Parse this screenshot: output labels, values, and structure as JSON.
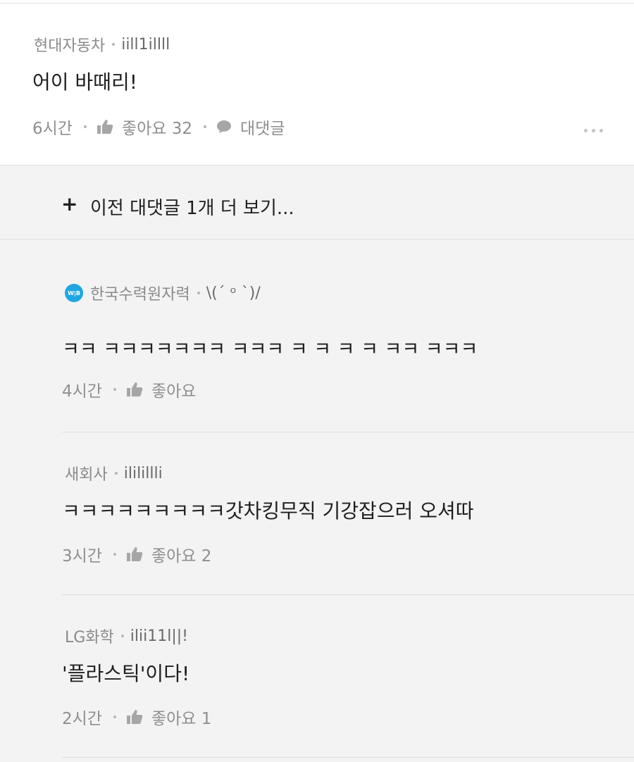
{
  "main_comment": {
    "company": "현대자동차",
    "user_id": "iill1illll",
    "text": "어이 바때리!",
    "time": "6시간",
    "like_label": "좋아요 32",
    "reply_label": "대댓글"
  },
  "prev_replies": {
    "plus": "+",
    "label": "이전 대댓글 1개 더 보기..."
  },
  "replies": [
    {
      "company": "한국수력원자력",
      "user_id": "\\(´ ᵒ `)/",
      "badge": "W|B",
      "text": "ㅋㅋ ㅋㅋㅋㅋㅋㅋㅋ ㅋㅋㅋ ㅋ ㅋ ㅋ ㅋ ㅋㅋ ㅋㅋㅋ",
      "time": "4시간",
      "like_label": "좋아요"
    },
    {
      "company": "새회사",
      "user_id": "ililillli",
      "text": "ㅋㅋㅋㅋㅋㅋㅋㅋㅋ갓차킹무직 기강잡으러 오셔따",
      "time": "3시간",
      "like_label": "좋아요 2"
    },
    {
      "company": "LG화학",
      "user_id": "ilii11l||!",
      "text": "'플라스틱'이다!",
      "time": "2시간",
      "like_label": "좋아요 1"
    }
  ],
  "icons": {
    "like": "thumbs-up-icon",
    "reply": "speech-bubble-icon",
    "more": "more-dots-icon"
  }
}
